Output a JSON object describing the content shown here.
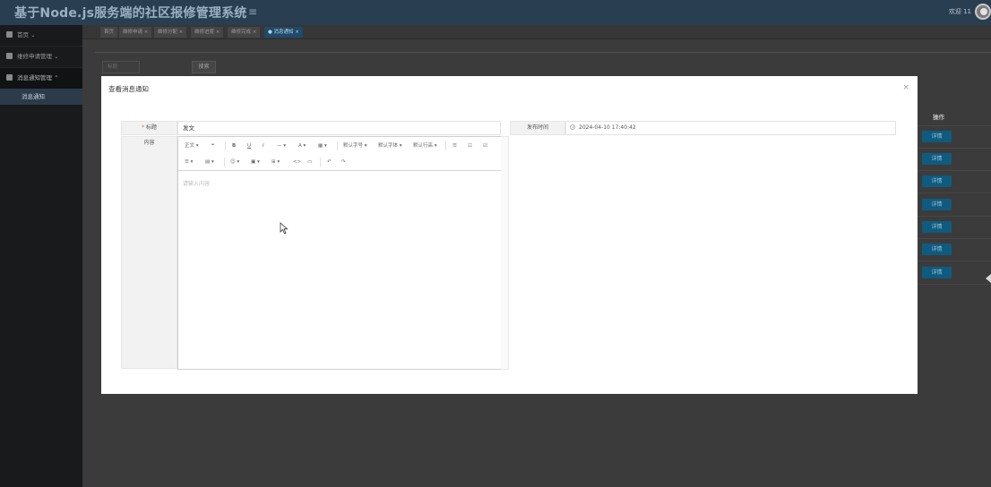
{
  "header": {
    "app_title": "基于Node.js服务端的社区报修管理系统",
    "menu_toggle_glyph": "≡",
    "welcome_text": "欢迎 11"
  },
  "sidebar": {
    "items": [
      {
        "label": "首页",
        "caret": "⌄"
      },
      {
        "label": "维修申请管理",
        "caret": "⌄"
      },
      {
        "label": "消息通知管理",
        "caret": "⌃"
      }
    ],
    "active_sub_item": "消息通知"
  },
  "tabs": [
    {
      "label": "首页",
      "closable": false
    },
    {
      "label": "维修申请 ×",
      "closable": true
    },
    {
      "label": "维修分配 ×",
      "closable": true
    },
    {
      "label": "维修进度 ×",
      "closable": true
    },
    {
      "label": "维修完成 ×",
      "closable": true
    },
    {
      "label": "● 消息通知 ×",
      "closable": true,
      "active": true
    }
  ],
  "list_page": {
    "search_placeholder": "标题",
    "search_button": "搜索",
    "column_header_op": "操作",
    "row_button": "详情",
    "row_count": 7
  },
  "modal": {
    "title": "查看消息通知",
    "close_glyph": "×",
    "title_label_required": "*",
    "title_label": "标题",
    "title_value": "发文",
    "content_label": "内容",
    "publish_time_label": "发布时间",
    "publish_time_value": "2024-04-10 17:40:42",
    "editor": {
      "toolbar_row1": [
        "正文 ▾",
        "❝",
        "B",
        "U",
        "I",
        "— ▾",
        "A ▾",
        "▦ ▾",
        "默认字号 ▾",
        "默认字体 ▾",
        "默认行高 ▾",
        "☰",
        "☷",
        "☑"
      ],
      "toolbar_row2": [
        "☰ ▾",
        "▤ ▾",
        "☺ ▾",
        "▣ ▾",
        "⊞ ▾",
        "<>",
        "▭",
        "↶",
        "↷"
      ],
      "placeholder": "请输入内容"
    }
  },
  "colors": {
    "header_bg": "#2a3e52",
    "sidebar_bg": "#181a1c",
    "accent_button": "#0f5b80",
    "modal_bg": "#ffffff"
  }
}
